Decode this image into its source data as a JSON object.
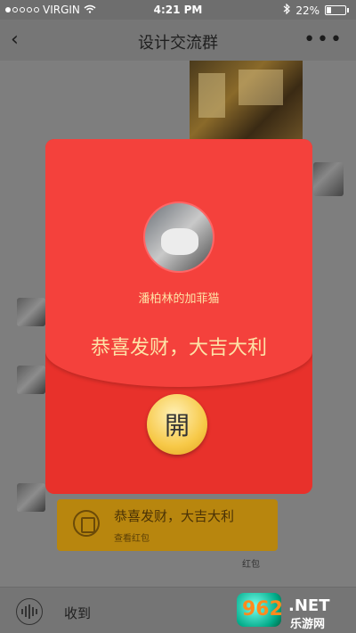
{
  "status_bar": {
    "carrier": "VIRGIN",
    "time": "4:21 PM",
    "battery": "22%"
  },
  "nav": {
    "back_icon": "‹",
    "title": "设计交流群",
    "more_icon": "•••"
  },
  "packet": {
    "sender_name": "潘柏林的加菲猫",
    "greeting": "恭喜发财，大吉大利",
    "open_label": "開"
  },
  "red_envelope_message": {
    "title": "恭喜发财，大吉大利",
    "subtitle": "查看红包",
    "tag": "红包"
  },
  "bottom_bar": {
    "text": "收到"
  },
  "watermark": {
    "number": "962",
    "suffix": ".NET",
    "site_name": "乐游网"
  },
  "colors": {
    "packet_red": "#e8312b",
    "packet_top_red": "#f4413c",
    "gold_text": "#fde3a7",
    "button_gold": "#f7c948",
    "bubble_gold": "#b8860e"
  },
  "icons": {
    "back": "chevron-left-icon",
    "more": "more-icon",
    "wifi": "wifi-icon",
    "bluetooth": "bluetooth-icon",
    "battery": "battery-icon",
    "voice": "voice-icon",
    "red_packet": "red-packet-icon"
  }
}
